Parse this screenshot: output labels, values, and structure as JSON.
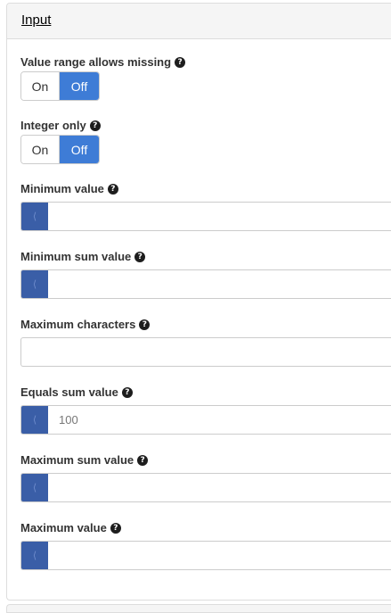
{
  "panel": {
    "title": "Input"
  },
  "fields": {
    "value_range_missing": {
      "label": "Value range allows missing",
      "on": "On",
      "off": "Off",
      "selected": "Off"
    },
    "integer_only": {
      "label": "Integer only",
      "on": "On",
      "off": "Off",
      "selected": "Off"
    },
    "minimum_value": {
      "label": "Minimum value",
      "value": ""
    },
    "minimum_sum_value": {
      "label": "Minimum sum value",
      "value": ""
    },
    "maximum_characters": {
      "label": "Maximum characters",
      "value": ""
    },
    "equals_sum_value": {
      "label": "Equals sum value",
      "value": "100"
    },
    "maximum_sum_value": {
      "label": "Maximum sum value",
      "value": ""
    },
    "maximum_value": {
      "label": "Maximum value",
      "value": ""
    }
  },
  "icons": {
    "help": "question-circle-icon",
    "handle": "drag-handle-icon"
  },
  "colors": {
    "toggle_active": "#3e7cd6",
    "handle": "#3a5ea7",
    "heading_bg": "#f5f5f5"
  }
}
